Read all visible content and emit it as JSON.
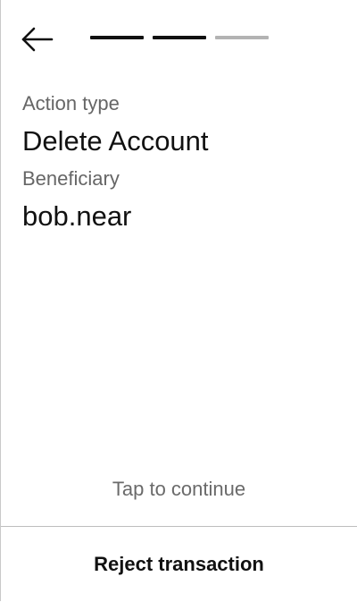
{
  "header": {
    "back_icon": "arrow-left-icon",
    "progress": {
      "total_steps": 3,
      "completed_steps": 2,
      "active_color": "#111111",
      "inactive_color": "#b3b3b3"
    }
  },
  "details": {
    "action_type_label": "Action type",
    "action_type_value": "Delete Account",
    "beneficiary_label": "Beneficiary",
    "beneficiary_value": "bob.near"
  },
  "footer": {
    "tap_hint": "Tap to continue",
    "reject_label": "Reject transaction"
  }
}
